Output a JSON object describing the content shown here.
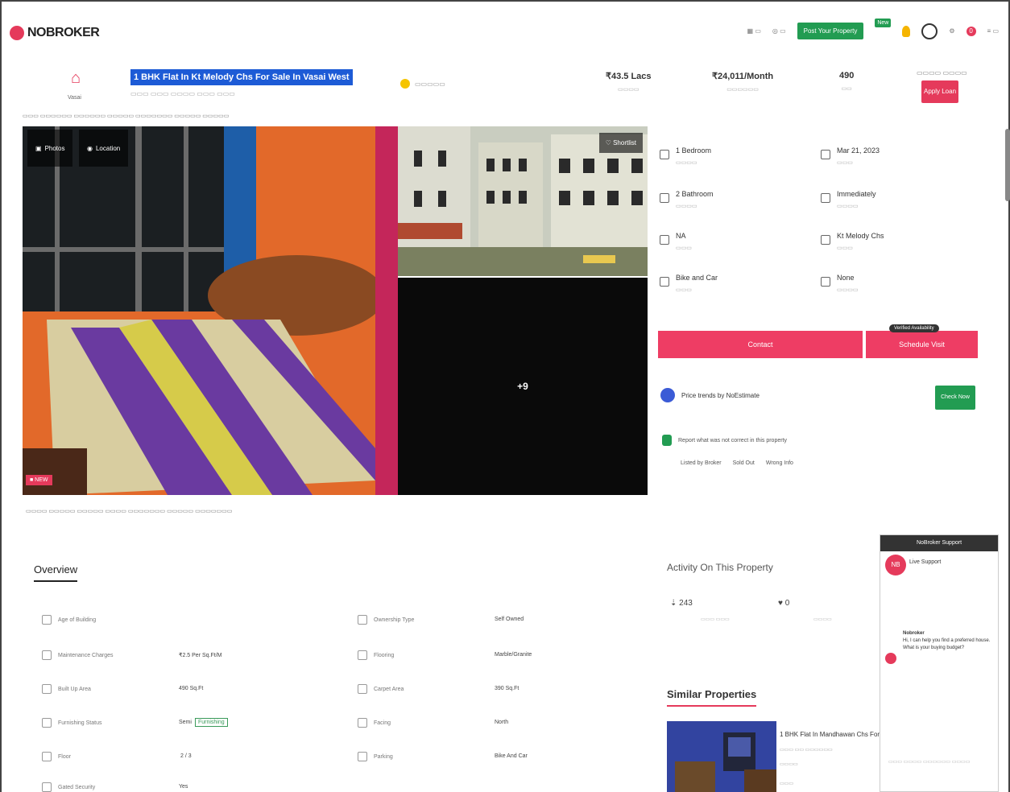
{
  "header": {
    "logo_text": "NOBROKER",
    "post_property": "Post Your Property",
    "new_badge": "New"
  },
  "property": {
    "title": "1 BHK Flat In Kt Melody Chs For Sale In Vasai West",
    "home_label": "Vasai",
    "price": "₹43.5 Lacs",
    "emi": "₹24,011/Month",
    "area": "490",
    "apply_btn": "Apply Loan"
  },
  "gallery": {
    "photos": "Photos",
    "location": "Location",
    "shortlist": "Shortlist",
    "more_photos": "+9"
  },
  "details": [
    {
      "value": "1 Bedroom",
      "col": 0
    },
    {
      "value": "Mar 21, 2023",
      "col": 1
    },
    {
      "value": "2 Bathroom",
      "col": 0
    },
    {
      "value": "Immediately",
      "col": 1
    },
    {
      "value": "NA",
      "col": 0
    },
    {
      "value": "Kt Melody Chs",
      "col": 1
    },
    {
      "value": "Bike and Car",
      "col": 0
    },
    {
      "value": "None",
      "col": 1
    }
  ],
  "actions": {
    "contact": "Contact",
    "schedule": "Schedule Visit",
    "verified_tip": "Verified Availability",
    "price_trends": "Price trends by NoEstimate",
    "check_now": "Check Now",
    "report": "Report what was not correct in this property",
    "links": [
      "Listed by Broker",
      "Sold Out",
      "Wrong Info"
    ]
  },
  "overview": {
    "title": "Overview",
    "rows": [
      {
        "label": "Age of Building",
        "value": "",
        "label2": "Ownership Type",
        "value2": "Self Owned"
      },
      {
        "label": "Maintenance Charges",
        "value": "₹2.5 Per Sq.Ft/M",
        "label2": "Flooring",
        "value2": "Marble/Granite"
      },
      {
        "label": "Built Up Area",
        "value": "490 Sq.Ft",
        "label2": "Carpet Area",
        "value2": "390 Sq.Ft"
      },
      {
        "label": "Furnishing Status",
        "value": "Semi",
        "label2": "Facing",
        "value2": "North"
      },
      {
        "label": "Floor",
        "value": "2 / 3",
        "label2": "Parking",
        "value2": "Bike And Car"
      },
      {
        "label": "Gated Security",
        "value": "Yes",
        "label2": "",
        "value2": ""
      }
    ],
    "furn_tag": "Furnishing"
  },
  "activity": {
    "title": "Activity On This Property",
    "views": "243",
    "shortlists": "0"
  },
  "similar": {
    "title": "Similar Properties",
    "item_title": "1 BHK Flat In Mandhawan Chs For"
  },
  "chat": {
    "header": "NoBroker Support",
    "agent_initials": "NB",
    "agent_name": "Live Support",
    "message": "Hi, I can help you find a preferred house. What is your buying budget?",
    "msg_sender": "Nobroker"
  }
}
